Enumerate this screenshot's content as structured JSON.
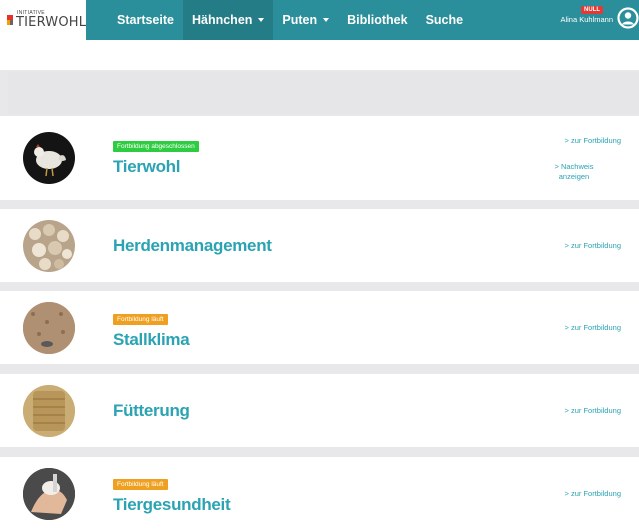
{
  "logo": {
    "small": "INITIATIVE",
    "big": "TIERWOHL"
  },
  "nav": [
    {
      "label": "Startseite"
    },
    {
      "label": "Hähnchen"
    },
    {
      "label": "Puten"
    },
    {
      "label": "Bibliothek"
    },
    {
      "label": "Suche"
    }
  ],
  "user": {
    "name": "Alina Kuhlmann",
    "badge": "NULL"
  },
  "courses": [
    {
      "title": "Tierwohl",
      "status": "Fortbildung abgeschlossen",
      "link": "> zur Fortbildung",
      "link2": "> Nachweis anzeigen"
    },
    {
      "title": "Herdenmanagement",
      "status": "",
      "link": "> zur Fortbildung"
    },
    {
      "title": "Stallklima",
      "status": "Fortbildung läuft",
      "link": "> zur Fortbildung"
    },
    {
      "title": "Fütterung",
      "status": "",
      "link": "> zur Fortbildung"
    },
    {
      "title": "Tiergesundheit",
      "status": "Fortbildung läuft",
      "link": "> zur Fortbildung"
    }
  ],
  "colors": {
    "header": "#2a8f9a",
    "accent": "#2aa3b3",
    "done": "#2ecc40",
    "running": "#f0a020"
  }
}
